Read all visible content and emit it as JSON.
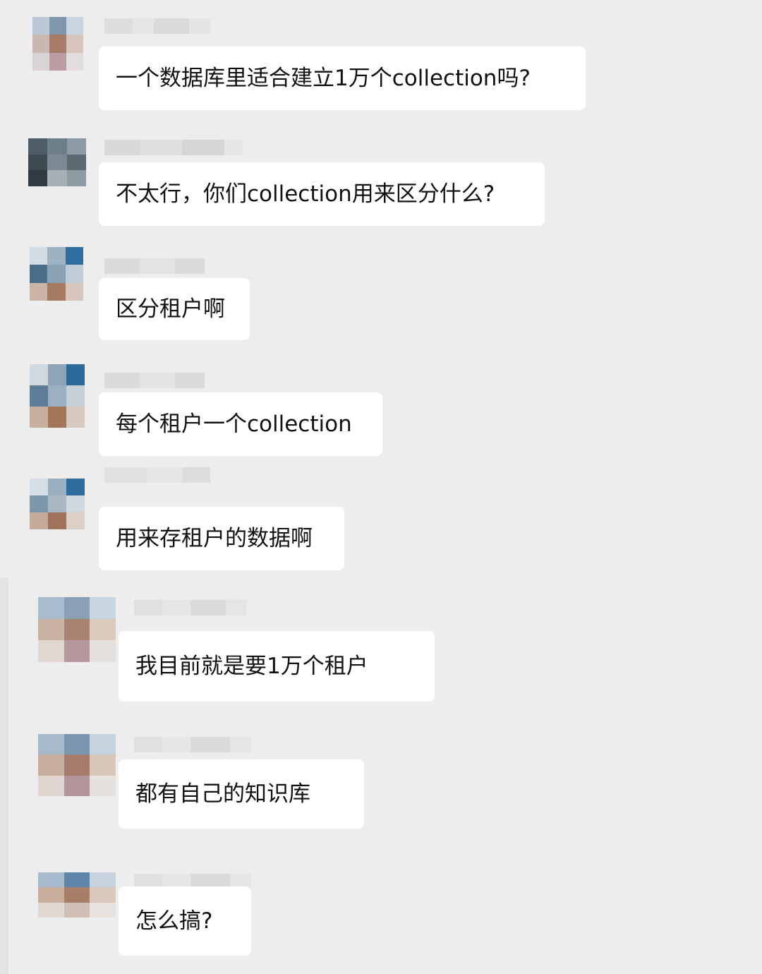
{
  "messages": [
    {
      "id": 1,
      "side": "left",
      "text": "一个数据库里适合建立1万个collection吗?"
    },
    {
      "id": 2,
      "side": "left",
      "text": "不太行，你们collection用来区分什么?"
    },
    {
      "id": 3,
      "side": "left",
      "text": "区分租户啊"
    },
    {
      "id": 4,
      "side": "left",
      "text": "每个租户一个collection"
    },
    {
      "id": 5,
      "side": "left",
      "text": "用来存租户的数据啊"
    },
    {
      "id": 6,
      "side": "left",
      "text": "我目前就是要1万个租户"
    },
    {
      "id": 7,
      "side": "left",
      "text": "都有自己的知识库"
    },
    {
      "id": 8,
      "side": "left",
      "text": "怎么搞?"
    }
  ],
  "colors": {
    "background": "#ededed",
    "bubble": "#ffffff",
    "text": "#111111"
  }
}
